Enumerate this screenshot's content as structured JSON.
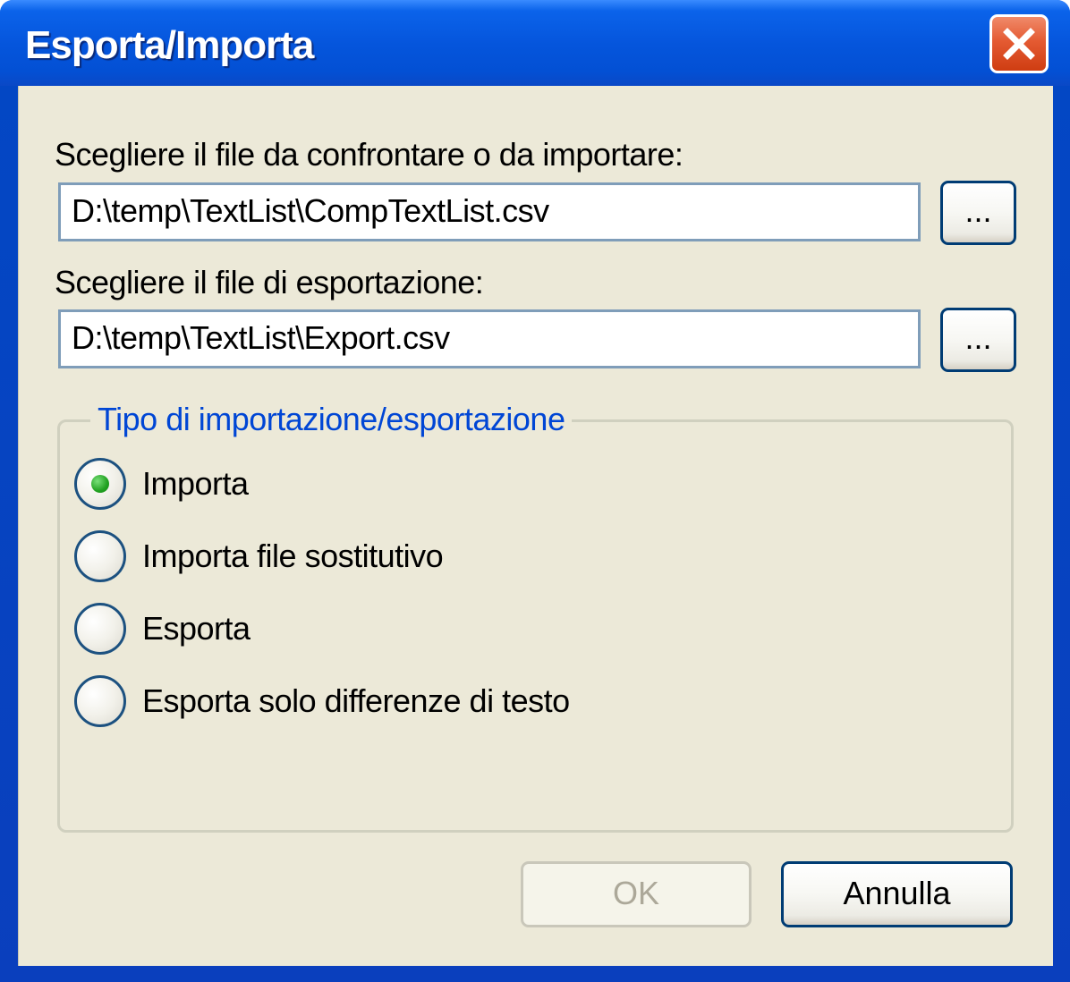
{
  "window": {
    "title": "Esporta/Importa",
    "close_icon": "close-icon"
  },
  "compare_file": {
    "label": "Scegliere il file da confrontare o da importare:",
    "value": "D:\\temp\\TextList\\CompTextList.csv",
    "browse_label": "..."
  },
  "export_file": {
    "label": "Scegliere il file di esportazione:",
    "value": "D:\\temp\\TextList\\Export.csv",
    "browse_label": "..."
  },
  "type_group": {
    "legend": "Tipo di importazione/esportazione",
    "options": [
      {
        "label": "Importa",
        "selected": true
      },
      {
        "label": "Importa file sostitutivo",
        "selected": false
      },
      {
        "label": "Esporta",
        "selected": false
      },
      {
        "label": "Esporta solo differenze di testo",
        "selected": false
      }
    ]
  },
  "buttons": {
    "ok_label": "OK",
    "ok_enabled": false,
    "cancel_label": "Annulla"
  },
  "colors": {
    "titlebar": "#0555dc",
    "dialog_background": "#ece9d8",
    "group_legend": "#0046d5",
    "radio_selected": "#21a121",
    "close_button": "#e45a32"
  }
}
